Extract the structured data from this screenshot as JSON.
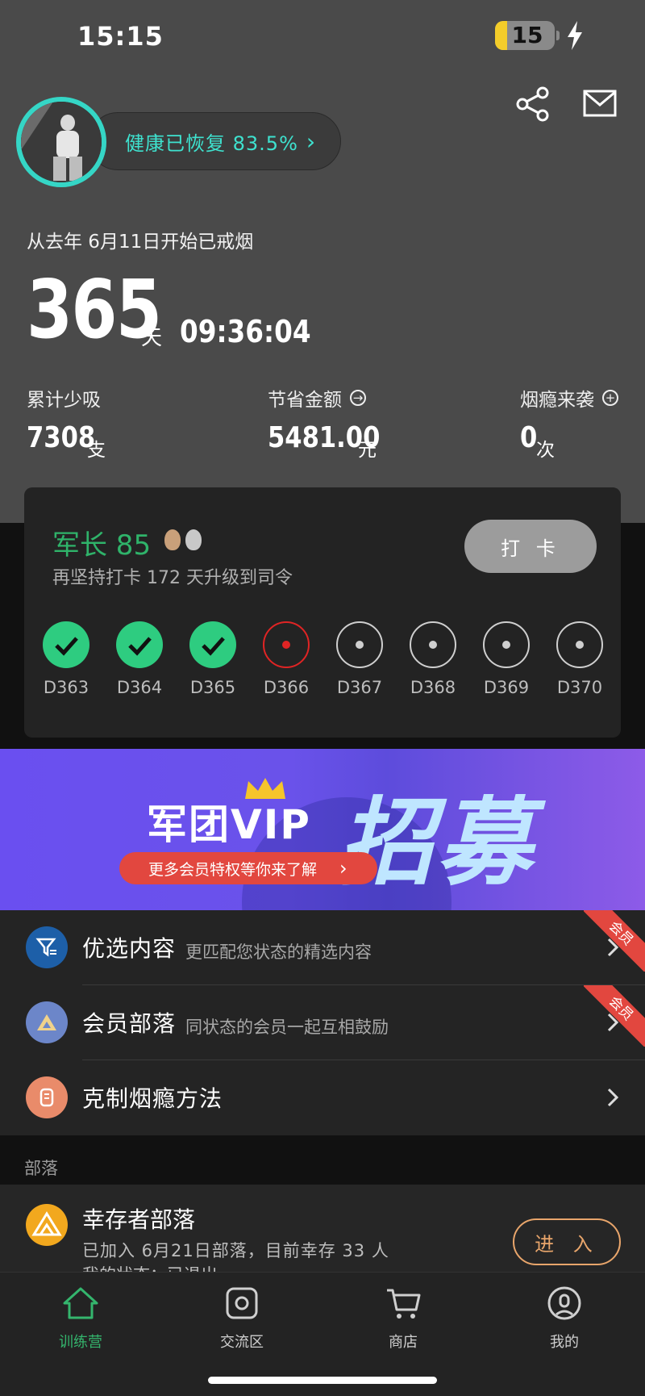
{
  "status_bar": {
    "time": "15:15",
    "battery": "15",
    "battery_level": 0.15
  },
  "profile": {
    "health_text": "健康已恢复 83.5%",
    "health_chevron": "›"
  },
  "quit": {
    "since_text": "从去年 6月11日开始已戒烟",
    "days": "365",
    "days_unit": "天",
    "timer": "09:36:04"
  },
  "stats": [
    {
      "label": "累计少吸",
      "value": "7308",
      "unit": "支",
      "icon": ""
    },
    {
      "label": "节省金额",
      "value": "5481.00",
      "unit": "元",
      "icon": "→"
    },
    {
      "label": "烟瘾来袭",
      "value": "0",
      "unit": "次",
      "icon": "+"
    }
  ],
  "rank": {
    "title": "军长 85",
    "subtitle": "再坚持打卡 172 天升级到司令",
    "checkin_label": "打 卡",
    "days": [
      {
        "label": "D363",
        "state": "done"
      },
      {
        "label": "D364",
        "state": "done"
      },
      {
        "label": "D365",
        "state": "done"
      },
      {
        "label": "D366",
        "state": "today"
      },
      {
        "label": "D367",
        "state": "pending"
      },
      {
        "label": "D368",
        "state": "pending"
      },
      {
        "label": "D369",
        "state": "pending"
      },
      {
        "label": "D370",
        "state": "pending"
      }
    ]
  },
  "banner": {
    "title": "军团VIP",
    "big_text": "招募",
    "pill_text": "更多会员特权等你来了解",
    "pill_arrow": "›"
  },
  "menu": [
    {
      "title": "优选内容",
      "desc": "更匹配您状态的精选内容",
      "badge": "会员",
      "icon": "filter-icon",
      "color": "#1d5fa8"
    },
    {
      "title": "会员部落",
      "desc": "同状态的会员一起互相鼓励",
      "badge": "会员",
      "icon": "tribe-icon",
      "color": "#6c86c9"
    },
    {
      "title": "克制烟瘾方法",
      "desc": "",
      "badge": "",
      "icon": "method-icon",
      "color": "#e98b6a"
    }
  ],
  "tribe": {
    "section_label": "部落",
    "name": "幸存者部落",
    "desc": "已加入 6月21日部落，目前幸存 33 人",
    "desc2": "我的状态：已退出",
    "enter_label": "进 入"
  },
  "tabs": [
    {
      "label": "训练营",
      "icon": "home-icon",
      "active": true
    },
    {
      "label": "交流区",
      "icon": "chat-icon",
      "active": false
    },
    {
      "label": "商店",
      "icon": "cart-icon",
      "active": false
    },
    {
      "label": "我的",
      "icon": "user-icon",
      "active": false
    }
  ],
  "colors": {
    "accent_green": "#34b56d",
    "health_cyan": "#3ee2cf",
    "badge_red": "#e2473f",
    "vip_purple": "#6a4ff0"
  }
}
